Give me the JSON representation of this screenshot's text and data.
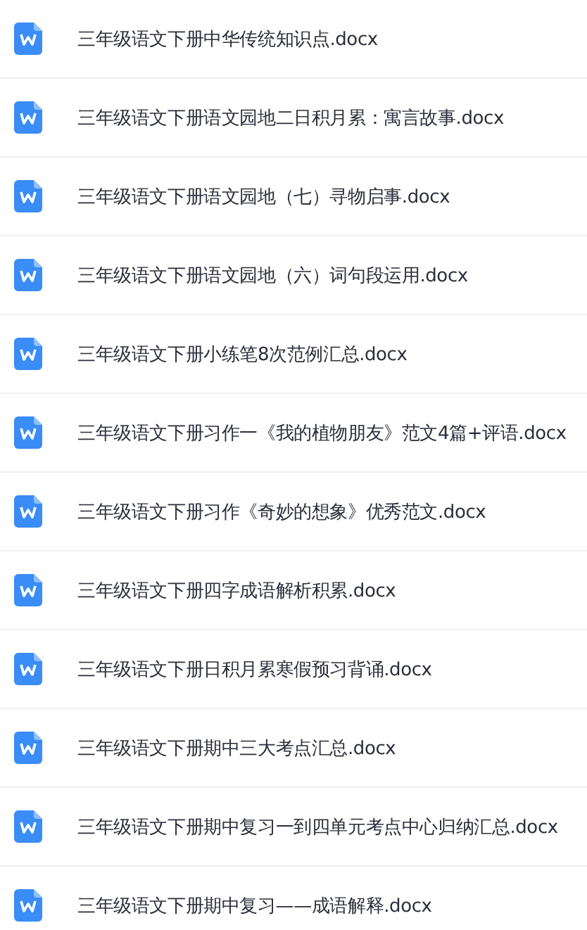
{
  "files": [
    {
      "name": "三年级语文下册中华传统知识点.docx"
    },
    {
      "name": "三年级语文下册语文园地二日积月累：寓言故事.docx"
    },
    {
      "name": "三年级语文下册语文园地（七）寻物启事.docx"
    },
    {
      "name": "三年级语文下册语文园地（六）词句段运用.docx"
    },
    {
      "name": "三年级语文下册小练笔8次范例汇总.docx"
    },
    {
      "name": "三年级语文下册习作一《我的植物朋友》范文4篇+评语.docx"
    },
    {
      "name": "三年级语文下册习作《奇妙的想象》优秀范文.docx"
    },
    {
      "name": "三年级语文下册四字成语解析积累.docx"
    },
    {
      "name": "三年级语文下册日积月累寒假预习背诵.docx"
    },
    {
      "name": "三年级语文下册期中三大考点汇总.docx"
    },
    {
      "name": "三年级语文下册期中复习一到四单元考点中心归纳汇总.docx"
    },
    {
      "name": "三年级语文下册期中复习——成语解释.docx"
    }
  ]
}
